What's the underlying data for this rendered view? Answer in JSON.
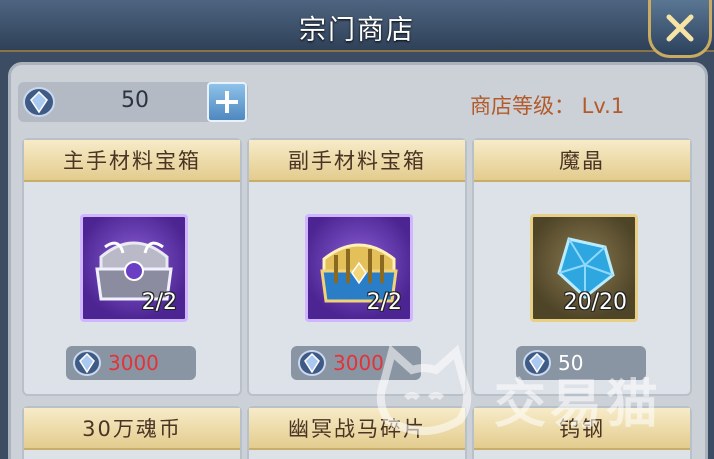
{
  "window": {
    "title": "宗门商店"
  },
  "currency": {
    "icon": "blue-gem-icon",
    "amount": "50"
  },
  "shop_level": {
    "text": "商店等级： Lv.1"
  },
  "items": [
    {
      "name": "主手材料宝箱",
      "icon": "purple-weapon-chest-icon",
      "count": "2/2",
      "price": "3000",
      "price_color": "#e3323a"
    },
    {
      "name": "副手材料宝箱",
      "icon": "gold-offhand-chest-icon",
      "count": "2/2",
      "price": "3000",
      "price_color": "#e3323a"
    },
    {
      "name": "魔晶",
      "icon": "magic-crystal-icon",
      "count": "20/20",
      "price": "50",
      "price_color": "#ffffff"
    }
  ],
  "items_row2": [
    {
      "name": "30万魂币"
    },
    {
      "name": "幽冥战马碎片"
    },
    {
      "name": "钨钢"
    }
  ],
  "watermark": {
    "text": "交易猫"
  },
  "colors": {
    "accent_gold": "#c9ab62",
    "price_insufficient": "#e3323a",
    "shop_level_text": "#b35a2a"
  }
}
